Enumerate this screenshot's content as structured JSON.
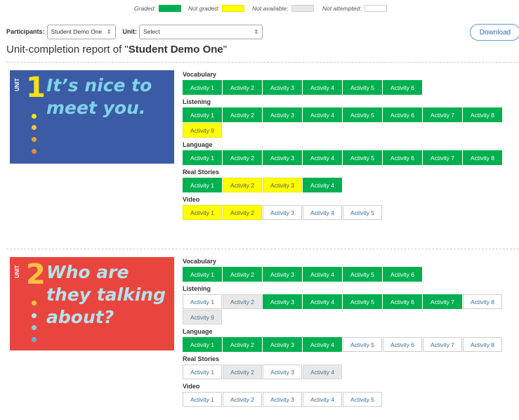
{
  "legend": {
    "graded": {
      "label": "Graded:",
      "color": "#00b050"
    },
    "not_graded": {
      "label": "Not graded:",
      "color": "#ffff00"
    },
    "not_available": {
      "label": "Not available:",
      "color": "#e8e8e8"
    },
    "not_attempted": {
      "label": "Not attempted:",
      "color": "#ffffff"
    }
  },
  "filters": {
    "participants_label": "Participants:",
    "participants_value": "Student Demo One",
    "unit_label": "Unit:",
    "unit_value": "Select"
  },
  "download_label": "Download",
  "report": {
    "title_prefix": "Unit-completion report of \"",
    "student_name": "Student Demo One",
    "title_suffix": "\""
  },
  "units": [
    {
      "cover": {
        "unit_word": "UNIT",
        "number": "1",
        "heading": "It’s nice to meet you.",
        "bg": "#3b5ba5",
        "text_color": "#7fd3e8",
        "number_color": "#f2e01e"
      },
      "sections": [
        {
          "label": "Vocabulary",
          "activities": [
            {
              "label": "Activity 1",
              "status": "graded"
            },
            {
              "label": "Activity 2",
              "status": "graded"
            },
            {
              "label": "Activity 3",
              "status": "graded"
            },
            {
              "label": "Activity 4",
              "status": "graded"
            },
            {
              "label": "Activity 5",
              "status": "graded"
            },
            {
              "label": "Activity 6",
              "status": "graded"
            }
          ]
        },
        {
          "label": "Listening",
          "activities": [
            {
              "label": "Activity 1",
              "status": "graded"
            },
            {
              "label": "Activity 2",
              "status": "graded"
            },
            {
              "label": "Activity 3",
              "status": "graded"
            },
            {
              "label": "Activity 4",
              "status": "graded"
            },
            {
              "label": "Activity 5",
              "status": "graded"
            },
            {
              "label": "Activity 6",
              "status": "graded"
            },
            {
              "label": "Activity 7",
              "status": "graded"
            },
            {
              "label": "Activity 8",
              "status": "graded"
            },
            {
              "label": "Activity 9",
              "status": "notgraded"
            }
          ]
        },
        {
          "label": "Language",
          "activities": [
            {
              "label": "Activity 1",
              "status": "graded"
            },
            {
              "label": "Activity 2",
              "status": "graded"
            },
            {
              "label": "Activity 3",
              "status": "graded"
            },
            {
              "label": "Activity 4",
              "status": "graded"
            },
            {
              "label": "Activity 5",
              "status": "graded"
            },
            {
              "label": "Activity 6",
              "status": "graded"
            },
            {
              "label": "Activity 7",
              "status": "graded"
            },
            {
              "label": "Activity 8",
              "status": "graded"
            }
          ]
        },
        {
          "label": "Real Stories",
          "activities": [
            {
              "label": "Activity 1",
              "status": "graded"
            },
            {
              "label": "Activity 2",
              "status": "notgraded"
            },
            {
              "label": "Activity 3",
              "status": "notgraded"
            },
            {
              "label": "Activity 4",
              "status": "graded"
            }
          ]
        },
        {
          "label": "Video",
          "activities": [
            {
              "label": "Activity 1",
              "status": "notgraded"
            },
            {
              "label": "Activity 2",
              "status": "notgraded"
            },
            {
              "label": "Activity 3",
              "status": "notattempted"
            },
            {
              "label": "Activity 4",
              "status": "notattempted"
            },
            {
              "label": "Activity 5",
              "status": "notattempted"
            }
          ]
        }
      ]
    },
    {
      "cover": {
        "unit_word": "UNIT",
        "number": "2",
        "heading": "Who are they talking about?",
        "bg": "#e9453f",
        "text_color": "#b5e3ec",
        "number_color": "#f5c242"
      },
      "sections": [
        {
          "label": "Vocabulary",
          "activities": [
            {
              "label": "Activity 1",
              "status": "graded"
            },
            {
              "label": "Activity 2",
              "status": "graded"
            },
            {
              "label": "Activity 3",
              "status": "graded"
            },
            {
              "label": "Activity 4",
              "status": "graded"
            },
            {
              "label": "Activity 5",
              "status": "graded"
            },
            {
              "label": "Activity 6",
              "status": "graded"
            }
          ]
        },
        {
          "label": "Listening",
          "activities": [
            {
              "label": "Activity 1",
              "status": "notattempted"
            },
            {
              "label": "Activity 2",
              "status": "notavailable"
            },
            {
              "label": "Activity 3",
              "status": "graded"
            },
            {
              "label": "Activity 4",
              "status": "graded"
            },
            {
              "label": "Activity 5",
              "status": "graded"
            },
            {
              "label": "Activity 6",
              "status": "graded"
            },
            {
              "label": "Activity 7",
              "status": "graded"
            },
            {
              "label": "Activity 8",
              "status": "notattempted"
            },
            {
              "label": "Activity 9",
              "status": "notavailable"
            }
          ]
        },
        {
          "label": "Language",
          "activities": [
            {
              "label": "Activity 1",
              "status": "graded"
            },
            {
              "label": "Activity 2",
              "status": "graded"
            },
            {
              "label": "Activity 3",
              "status": "graded"
            },
            {
              "label": "Activity 4",
              "status": "graded"
            },
            {
              "label": "Activity 5",
              "status": "notattempted"
            },
            {
              "label": "Activity 6",
              "status": "notattempted"
            },
            {
              "label": "Activity 7",
              "status": "notattempted"
            },
            {
              "label": "Activity 8",
              "status": "notattempted"
            }
          ]
        },
        {
          "label": "Real Stories",
          "activities": [
            {
              "label": "Activity 1",
              "status": "notattempted"
            },
            {
              "label": "Activity 2",
              "status": "notavailable"
            },
            {
              "label": "Activity 3",
              "status": "notattempted"
            },
            {
              "label": "Activity 4",
              "status": "notavailable"
            }
          ]
        },
        {
          "label": "Video",
          "activities": [
            {
              "label": "Activity 1",
              "status": "notattempted"
            },
            {
              "label": "Activity 2",
              "status": "notattempted"
            },
            {
              "label": "Activity 3",
              "status": "notattempted"
            },
            {
              "label": "Activity 4",
              "status": "notattempted"
            },
            {
              "label": "Activity 5",
              "status": "notattempted"
            }
          ]
        }
      ]
    }
  ]
}
